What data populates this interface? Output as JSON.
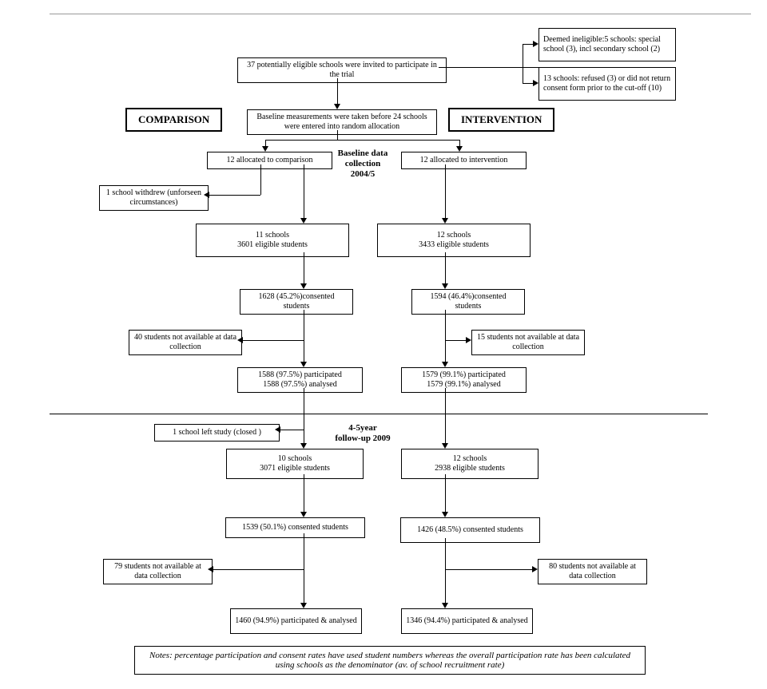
{
  "top": {
    "eligible": "37 potentially eligible schools were invited to participate in the trial",
    "ineligible": "Deemed ineligible:5 schools: special school (3), incl secondary school (2)",
    "refused": "13 schools: refused (3) or did not return consent form prior to the cut-off (10)",
    "baseline": "Baseline measurements were taken before 24 schools were entered into random allocation"
  },
  "headers": {
    "comparison": "COMPARISON",
    "intervention": "INTERVENTION"
  },
  "labels": {
    "baseline": "Baseline data collection 2004/5",
    "followup": "4-5year follow-up 2009"
  },
  "comp": {
    "alloc": "12   allocated to comparison",
    "withdrew": "1   school withdrew (unforseen circumstances)",
    "schools1": "11 schools\n3601 eligible students",
    "consent1": "1628 (45.2%)consented students",
    "notavail1": "40 students not available at data collection",
    "part1": "1588 (97.5%) participated\n1588 (97.5%) analysed",
    "left": "1 school left study (closed )",
    "schools2": "10 schools\n3071 eligible students",
    "consent2": "1539 (50.1%) consented students",
    "notavail2": "79  students not available at data collection",
    "part2": "1460 (94.9%) participated & analysed"
  },
  "int": {
    "alloc": "12   allocated to intervention",
    "schools1": "12 schools\n3433 eligible students",
    "consent1": "1594 (46.4%)consented students",
    "notavail1": "15 students not available at data collection",
    "part1": "1579 (99.1%) participated\n1579 (99.1%) analysed",
    "schools2": "12 schools\n2938 eligible students",
    "consent2": "1426 (48.5%) consented students",
    "notavail2": "80 students not available at data collection",
    "part2": "1346 (94.4%) participated & analysed"
  },
  "note": "Notes: percentage participation and consent rates have used student numbers whereas the overall participation rate has been calculated using schools as the denominator (av. of school recruitment rate)"
}
